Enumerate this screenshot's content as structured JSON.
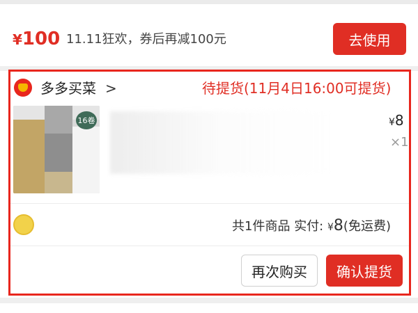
{
  "coupon": {
    "currency": "¥",
    "amount": "100",
    "description": "11.11狂欢，券后再减100元",
    "use_label": "去使用"
  },
  "order": {
    "store_name": "多多买菜",
    "store_chevron": ">",
    "pickup_status": "待提货(11月4日16:00可提货)",
    "product": {
      "badge": "16卷",
      "price_currency": "¥",
      "price": "8",
      "quantity": "×1"
    },
    "summary": {
      "count_label": "共1件商品",
      "paid_label": "实付:",
      "currency": "¥",
      "amount": "8",
      "shipping_note": "(免运费)"
    },
    "actions": {
      "reorder_label": "再次购买",
      "confirm_label": "确认提货"
    }
  },
  "colors": {
    "accent": "#e02e24",
    "highlight_frame": "#e8261d"
  },
  "icons": {
    "store_logo": "carrot-logo-icon",
    "avatar": "user-avatar-icon"
  }
}
